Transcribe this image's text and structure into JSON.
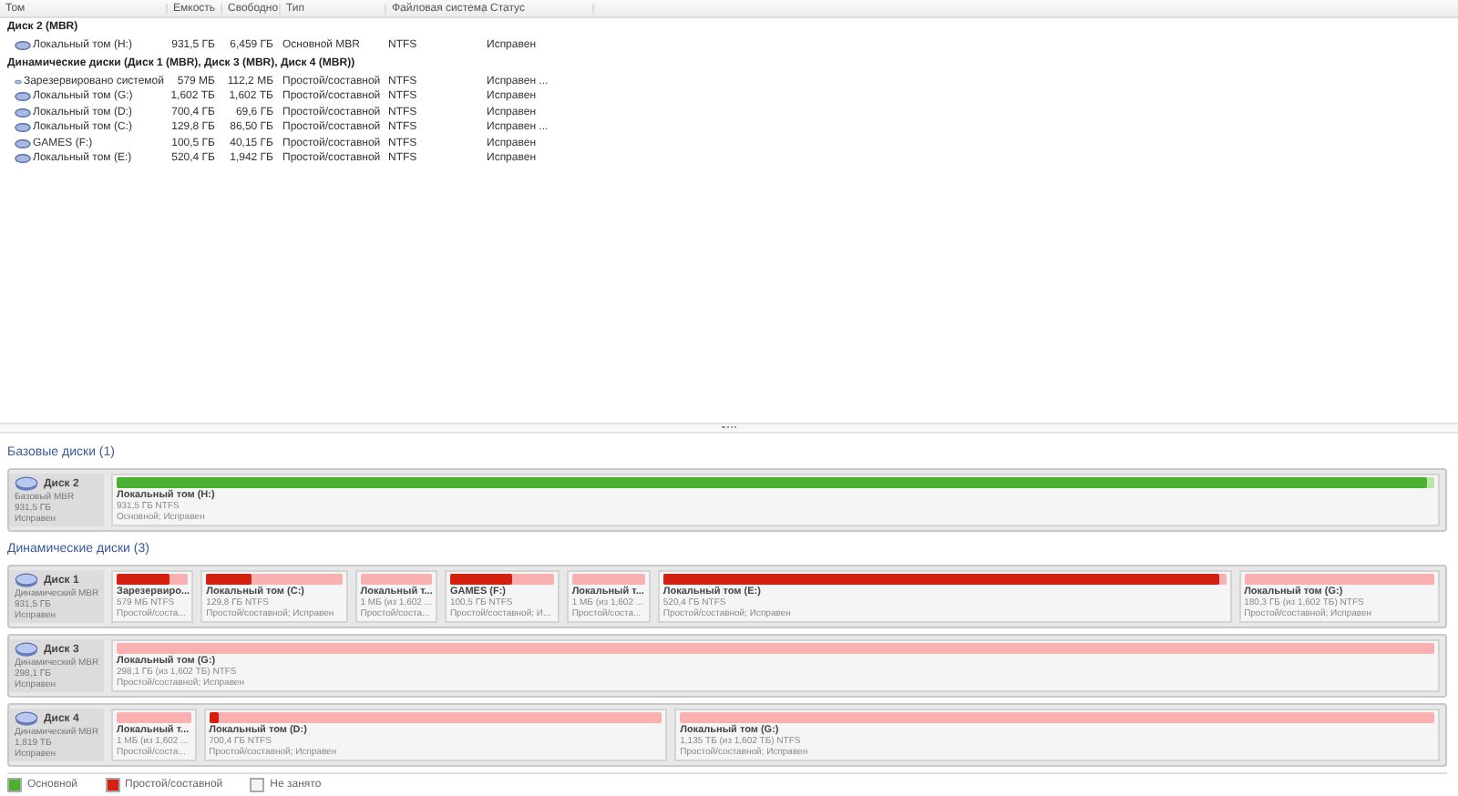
{
  "table": {
    "columns": [
      "Том",
      "Емкость",
      "Свободно",
      "Тип",
      "Файловая система",
      "Статус"
    ],
    "groups": [
      {
        "title": "Диск 2 (MBR)",
        "rows": [
          {
            "cells": [
              "Локальный том (H:)",
              "931,5 ГБ",
              "6,459 ГБ",
              "Основной MBR",
              "NTFS",
              "Исправен"
            ]
          }
        ]
      },
      {
        "title": "Динамические диски (Диск 1 (MBR), Диск 3 (MBR), Диск 4 (MBR))",
        "rows": [
          {
            "cells": [
              "Зарезервировано системой",
              "579 МБ",
              "112,2 МБ",
              "Простой/составной",
              "NTFS",
              "Исправен ..."
            ]
          },
          {
            "cells": [
              "Локальный том (G:)",
              "1,602 ТБ",
              "1,602 ТБ",
              "Простой/составной",
              "NTFS",
              "Исправен"
            ]
          },
          {
            "cells": [
              "Локальный том (D:)",
              "700,4 ГБ",
              "69,6 ГБ",
              "Простой/составной",
              "NTFS",
              "Исправен"
            ]
          },
          {
            "cells": [
              "Локальный том (C:)",
              "129,8 ГБ",
              "86,50 ГБ",
              "Простой/составной",
              "NTFS",
              "Исправен ..."
            ]
          },
          {
            "cells": [
              "GAMES (F:)",
              "100,5 ГБ",
              "40,15 ГБ",
              "Простой/составной",
              "NTFS",
              "Исправен"
            ]
          },
          {
            "cells": [
              "Локальный том (E:)",
              "520,4 ГБ",
              "1,942 ГБ",
              "Простой/составной",
              "NTFS",
              "Исправен"
            ]
          }
        ]
      }
    ]
  },
  "sections": [
    {
      "title": "Базовые диски (1)",
      "disks": [
        {
          "name": "Диск 2",
          "type": "Базовый MBR",
          "size": "931,5 ГБ",
          "status": "Исправен",
          "partitions": [
            {
              "kind": "basic",
              "level": 0.995,
              "title": "Локальный том (H:)",
              "size": "931,5 ГБ NTFS",
              "status": "Основной; Исправен"
            }
          ]
        }
      ]
    },
    {
      "title": "Динамические диски (3)",
      "disks": [
        {
          "name": "Диск 1",
          "type": "Динамический MBR",
          "size": "931,5 ГБ",
          "status": "Исправен",
          "partitions": [
            {
              "kind": "simple",
              "level": 0.75,
              "title": "Зарезервиро...",
              "size": "579 МБ NTFS",
              "status": "Простой/соста..."
            },
            {
              "kind": "simple",
              "level": 0.33,
              "title": "Локальный том (C:)",
              "size": "129,8 ГБ NTFS",
              "status": "Простой/составной; Исправен"
            },
            {
              "kind": "simple",
              "title": "Локальный т...",
              "size": "1 МБ (из 1,602 ...",
              "status": "Простой/соста..."
            },
            {
              "kind": "simple",
              "level": 0.6,
              "title": "GAMES (F:)",
              "size": "100,5 ГБ NTFS",
              "status": "Простой/составной; И..."
            },
            {
              "kind": "simple",
              "title": "Локальный т...",
              "size": "1 МБ (из 1,602 ...",
              "status": "Простой/соста..."
            },
            {
              "kind": "simple",
              "level": 0.99,
              "title": "Локальный том (E:)",
              "size": "520,4 ГБ NTFS",
              "status": "Простой/составной; Исправен"
            },
            {
              "kind": "simple",
              "title": "Локальный том (G:)",
              "size": "180,3 ГБ (из 1,602 ТБ) NTFS",
              "status": "Простой/составной; Исправен"
            }
          ]
        },
        {
          "name": "Диск 3",
          "type": "Динамический MBR",
          "size": "298,1 ГБ",
          "status": "Исправен",
          "partitions": [
            {
              "kind": "simple",
              "title": "Локальный том (G:)",
              "size": "298,1 ГБ (из 1,602 ТБ) NTFS",
              "status": "Простой/составной; Исправен"
            }
          ]
        },
        {
          "name": "Диск 4",
          "type": "Динамический MBR",
          "size": "1,819 ТБ",
          "status": "Исправен",
          "partitions": [
            {
              "kind": "simple",
              "title": "Локальный т...",
              "size": "1 МБ (из 1,602 ...",
              "status": "Простой/соста..."
            },
            {
              "kind": "simple",
              "level": 0.02,
              "title": "Локальный том (D:)",
              "size": "700,4 ГБ NTFS",
              "status": "Простой/составной; Исправен"
            },
            {
              "kind": "simple",
              "title": "Локальный том (G:)",
              "size": "1,135 ТБ (из 1,602 ТБ) NTFS",
              "status": "Простой/составной; Исправен"
            }
          ]
        }
      ]
    }
  ],
  "legend": [
    {
      "label": "Основной",
      "color": "#4caf32"
    },
    {
      "label": "Простой/составной",
      "color": "#d42010"
    },
    {
      "label": "Не занято",
      "color": "#f4f4f4"
    }
  ]
}
